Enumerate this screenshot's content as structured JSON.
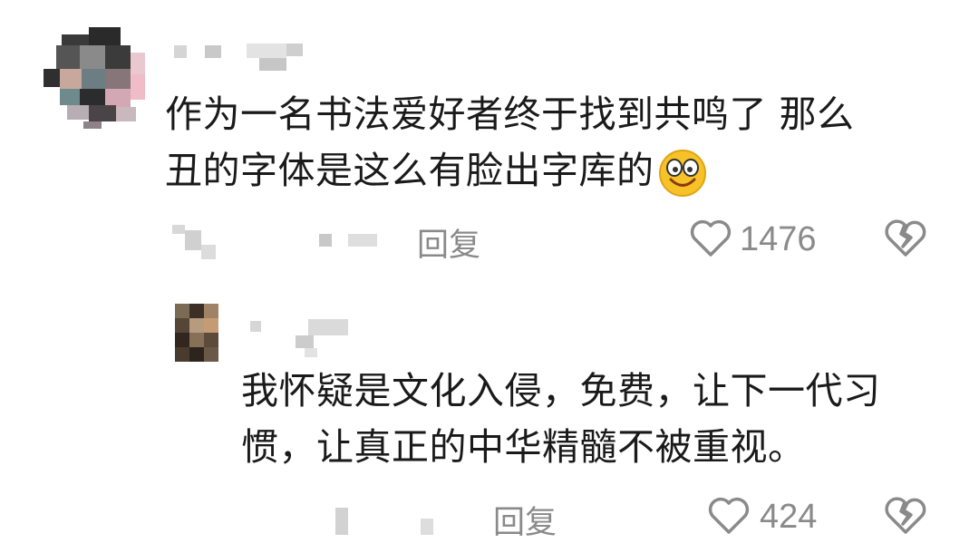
{
  "comments": [
    {
      "text_line1": "作为一名书法爱好者终于找到共鸣了 那么",
      "text_line2": "丑的字体是这么有脸出字库的",
      "emoji": "smiling-face-emoji",
      "reply_label": "回复",
      "like_count": "1476"
    },
    {
      "text_line1": "我怀疑是文化入侵，免费，让下一代习",
      "text_line2": "惯，让真正的中华精髓不被重视。",
      "reply_label": "回复",
      "like_count": "424"
    }
  ],
  "icons": {
    "like": "heart-outline-icon",
    "dislike": "broken-heart-icon"
  },
  "colors": {
    "text": "#1a1a1a",
    "meta": "#8a8a8a",
    "emoji_face": "#f7c227"
  }
}
